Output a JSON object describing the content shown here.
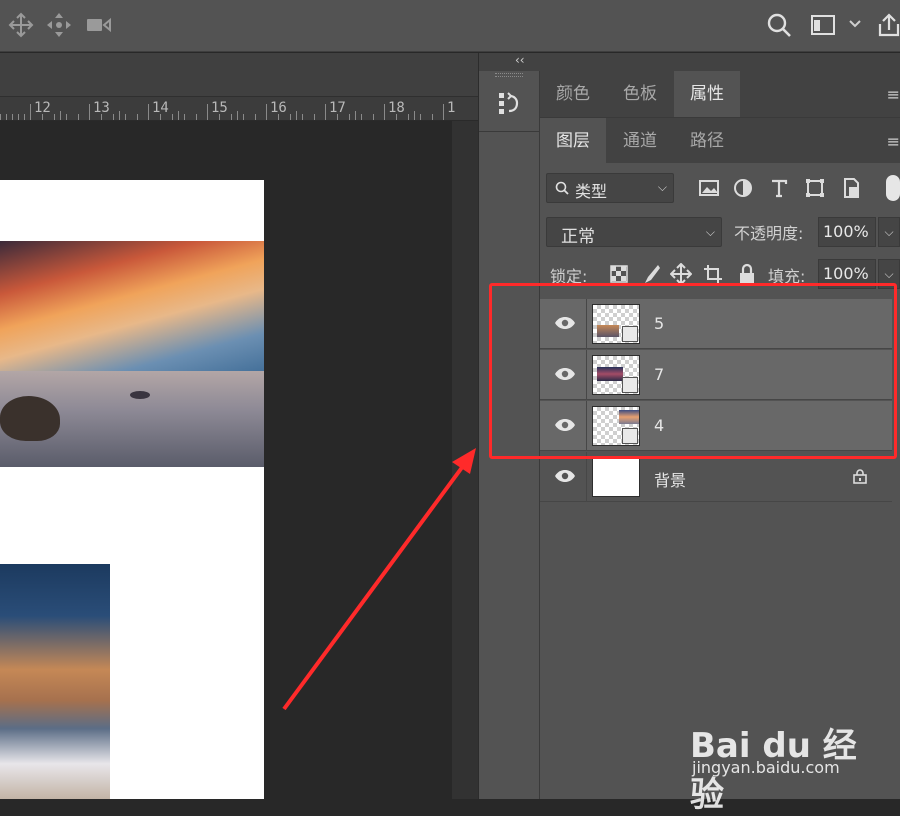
{
  "ruler": {
    "numbers": [
      "12",
      "13",
      "14",
      "15",
      "16",
      "17",
      "18",
      "1"
    ]
  },
  "panel_tabs_top": [
    "颜色",
    "色板",
    "属性"
  ],
  "panel_tabs_layers": [
    "图层",
    "通道",
    "路径"
  ],
  "filter": {
    "label": "类型"
  },
  "blend": {
    "mode": "正常",
    "opacity_label": "不透明度:",
    "opacity_value": "100%"
  },
  "lock": {
    "label": "锁定:",
    "fill_label": "填充:",
    "fill_value": "100%"
  },
  "layers": [
    {
      "name": "5",
      "selected": true,
      "smart_object": true
    },
    {
      "name": "7",
      "selected": true,
      "smart_object": true
    },
    {
      "name": "4",
      "selected": true,
      "smart_object": true
    },
    {
      "name": "背景",
      "selected": false,
      "locked": true
    }
  ],
  "annotation": {
    "color": "#ff2a2a"
  },
  "watermark": {
    "brand": "Bai du 经验",
    "url": "jingyan.baidu.com"
  },
  "colors": {
    "panel_bg": "#535353",
    "selected_layer": "#686868",
    "canvas_bg": "#282828"
  }
}
